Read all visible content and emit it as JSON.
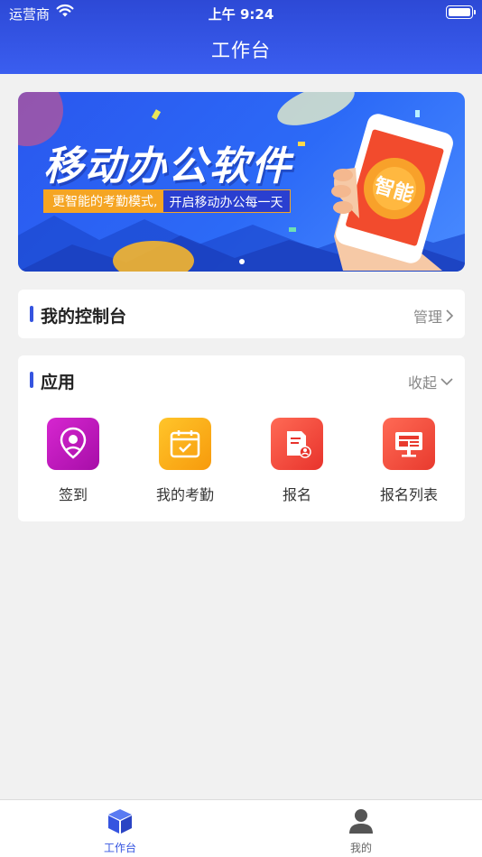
{
  "status_bar": {
    "carrier": "运营商",
    "time": "上午 9:24"
  },
  "header": {
    "title": "工作台"
  },
  "banner": {
    "headline": "移动办公软件",
    "sub_left": "更智能的考勤模式,",
    "sub_right": "开启移动办公每一天",
    "phone_badge": "智能"
  },
  "console_card": {
    "title": "我的控制台",
    "action": "管理"
  },
  "apps_card": {
    "title": "应用",
    "action": "收起",
    "items": [
      {
        "label": "签到",
        "icon": "location-pin-icon",
        "color": "#c316c0"
      },
      {
        "label": "我的考勤",
        "icon": "calendar-check-icon",
        "color": "#f7a81b"
      },
      {
        "label": "报名",
        "icon": "signup-form-icon",
        "color": "#f0493b"
      },
      {
        "label": "报名列表",
        "icon": "monitor-list-icon",
        "color": "#f0453b"
      }
    ]
  },
  "tabbar": {
    "items": [
      {
        "label": "工作台",
        "icon": "cube-icon",
        "active": true
      },
      {
        "label": "我的",
        "icon": "person-icon",
        "active": false
      }
    ]
  },
  "colors": {
    "accent": "#3554e0",
    "header": "#3458e8",
    "background": "#f1f1f1"
  }
}
